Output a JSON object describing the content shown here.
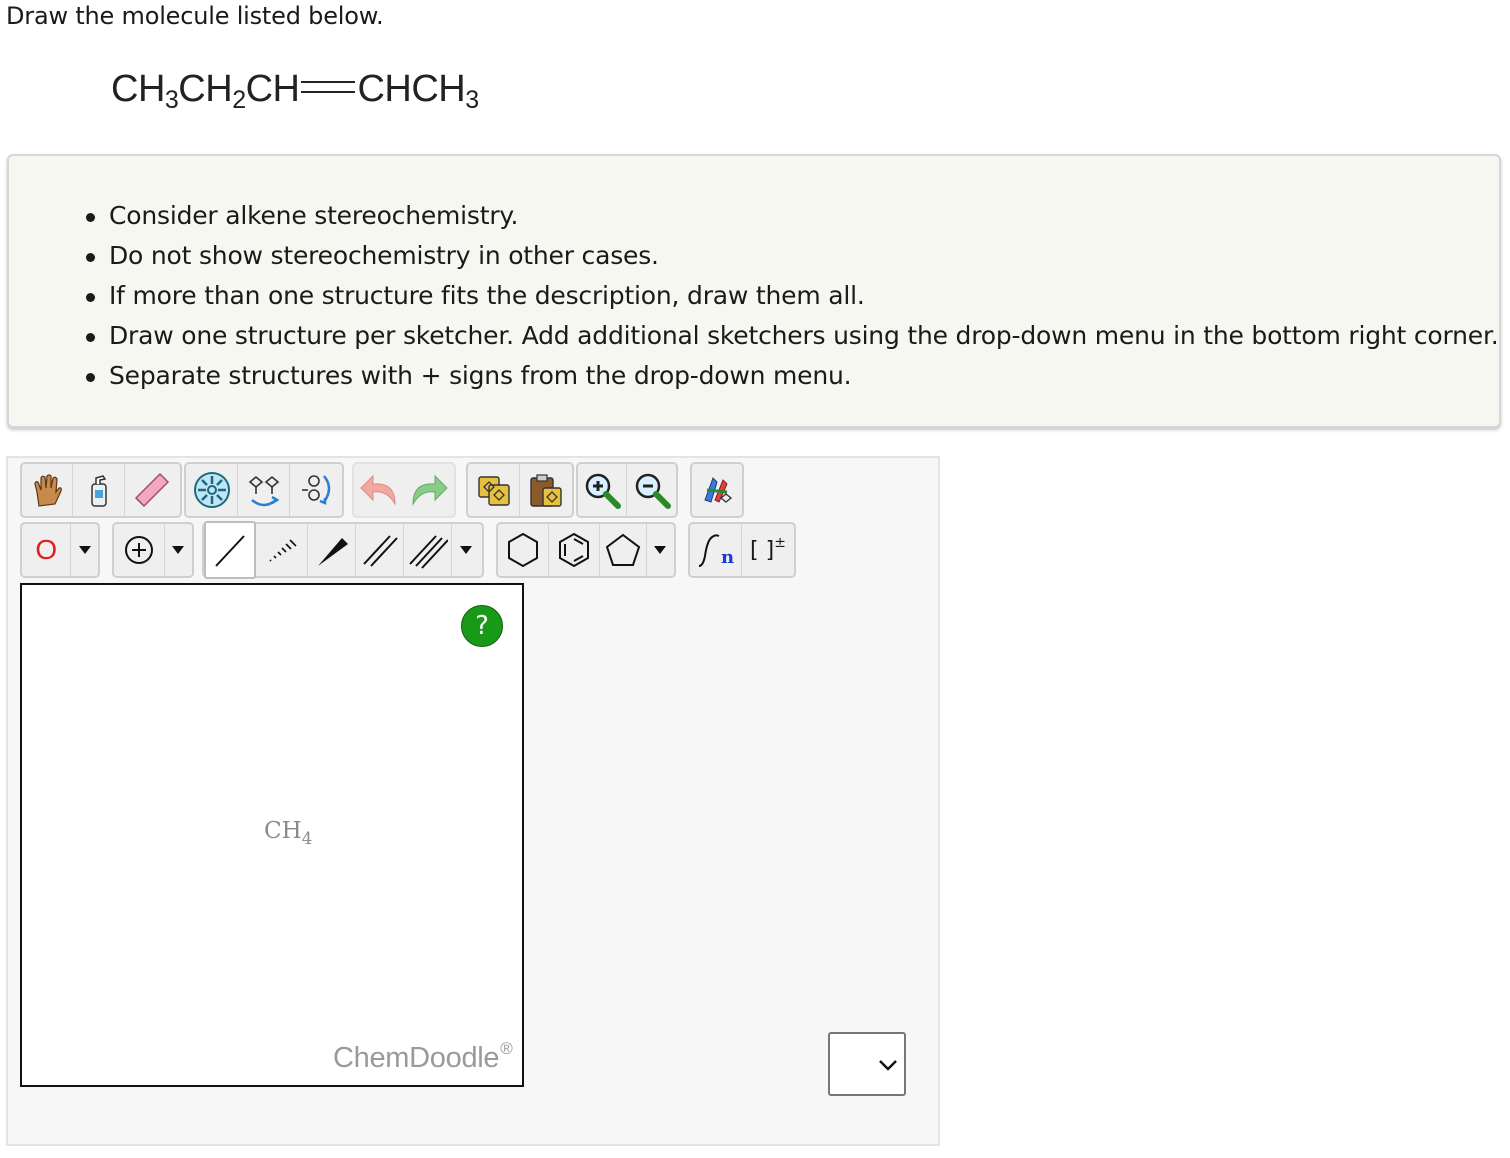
{
  "prompt": "Draw the molecule listed below.",
  "formula": {
    "p1": "CH",
    "s1": "3",
    "p2": "CH",
    "s2": "2",
    "p3": "CH",
    "p4": "CHCH",
    "s4": "3"
  },
  "instructions": [
    "Consider alkene stereochemistry.",
    "Do not show stereochemistry in other cases.",
    "If more than one structure fits the description, draw them all.",
    "Draw one structure per sketcher. Add additional sketchers using the drop-down menu in the bottom right corner.",
    "Separate structures with + signs from the drop-down menu."
  ],
  "toolbar": {
    "atom_label": "O",
    "atom_color": "#e02020",
    "template_n_label": "n",
    "bracket_label": "[ ]",
    "bracket_sup": "±",
    "icons": [
      "hand-icon",
      "clear-icon",
      "eraser-icon",
      "center-icon",
      "flip-icon",
      "rotate-icon",
      "undo-icon",
      "redo-icon",
      "copy-icon",
      "paste-icon",
      "zoom-in-icon",
      "zoom-out-icon",
      "cleanup-icon"
    ]
  },
  "sketcher": {
    "help_label": "?",
    "molecule": "CH",
    "molecule_sub": "4",
    "brand": "ChemDoodle",
    "brand_mark": "®"
  },
  "colors": {
    "help": "#189a18",
    "panel": "#f7f7f7",
    "instructions_bg": "#f7f7f2"
  }
}
